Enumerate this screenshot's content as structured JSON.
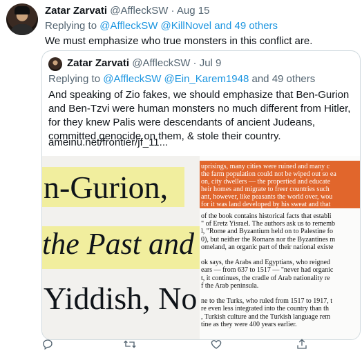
{
  "tweet": {
    "author": "Zatar Zarvati",
    "handle": "@AffleckSW",
    "sep": "·",
    "date": "Aug 15",
    "replying_prefix": "Replying to",
    "replying_users": "@AffleckSW @KillNovel",
    "replying_and": "and",
    "replying_others": "49 others",
    "text": "We must emphasize who true monsters in this conflict are."
  },
  "quoted": {
    "author": "Zatar Zarvati",
    "handle": "@AffleckSW",
    "sep": "·",
    "date": "Jul 9",
    "replying_prefix": "Replying to",
    "replying_users": "@AffleckSW @Ein_Karem1948",
    "replying_and": "and",
    "replying_others": "49 others",
    "text": "And speaking of Zio fakes, we should emphasize that Ben-Gurion and Ben-Tzvi were human monsters no much different from Hitler, for they knew Palis were descendants of ancient Judeans, committed genocide on them, & stole their country.",
    "link": "ameinu.net/frontier/jf_11..."
  },
  "image": {
    "left": {
      "line1": "n-Gurion,",
      "line2": "the Past and",
      "line3": "Yiddish, No"
    },
    "right_orange": [
      "uprisings, many cities were ruined and many c",
      "the farm population could not be wiped out so ea",
      "on, city dwellers — the propertied and educate",
      "heir homes and migrate to freer countries such",
      "ant, however, like peasants the world over, wou",
      "for it was land developed by his sweat and that"
    ],
    "right_body": [
      "of the book contains historical facts that establi",
      "\" of Eretz Yisrael. The authors ask us to rememb",
      "l, \"Rome and Byzantium held on to Palestine fo",
      "0), but neither the Romans nor the Byzantines m",
      "omeland, an organic part of their national existe",
      "",
      "ok says, the Arabs and Egyptians, who reigned",
      "ears — from 637 to 1517 — \"never had organic",
      "t, it continues, the cradle of Arab nationality re",
      "f the Arab peninsula.",
      "",
      "ne to the Turks, who ruled from 1517 to 1917, t",
      "re even less integrated into the country than th",
      ", Turkish culture and the Turkish language rem",
      "tine as they were 400 years earlier."
    ]
  },
  "actions": {
    "reply_icon": "reply-icon",
    "retweet_icon": "retweet-icon",
    "like_icon": "heart-icon",
    "share_icon": "share-icon"
  },
  "colors": {
    "link": "#1b95e0",
    "muted": "#536471",
    "highlight": "#f1ee9e",
    "orange": "#e1662c"
  }
}
